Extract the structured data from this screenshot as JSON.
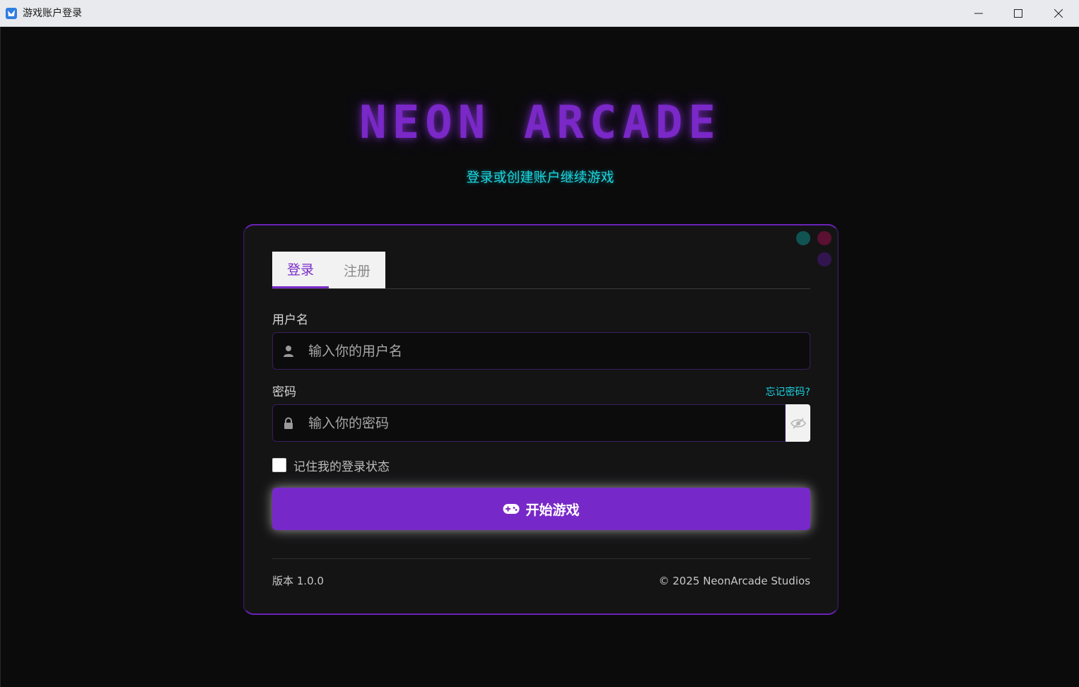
{
  "window": {
    "title": "游戏账户登录",
    "controls": [
      "minimize-icon",
      "maximize-icon",
      "close-icon"
    ]
  },
  "brand": {
    "logo": "NEON ARCADE",
    "subtitle": "登录或创建账户继续游戏",
    "colors": {
      "accent": "#7728c9",
      "cyan": "#19d6e0",
      "background": "#0b0b0c"
    }
  },
  "tabs": [
    {
      "label": "登录",
      "active": true
    },
    {
      "label": "注册",
      "active": false
    }
  ],
  "form": {
    "username": {
      "label": "用户名",
      "placeholder": "输入你的用户名",
      "value": "",
      "icon": "user-icon"
    },
    "password": {
      "label": "密码",
      "placeholder": "输入你的密码",
      "value": "",
      "icon": "lock-icon",
      "forgot_label": "忘记密码?",
      "toggle_icon": "eye-slash-icon"
    },
    "remember": {
      "label": "记住我的登录状态",
      "checked": false
    },
    "submit": {
      "label": "开始游戏",
      "icon": "gamepad-icon"
    }
  },
  "footer": {
    "version": "版本 1.0.0",
    "copyright": "© 2025 NeonArcade Studios"
  }
}
